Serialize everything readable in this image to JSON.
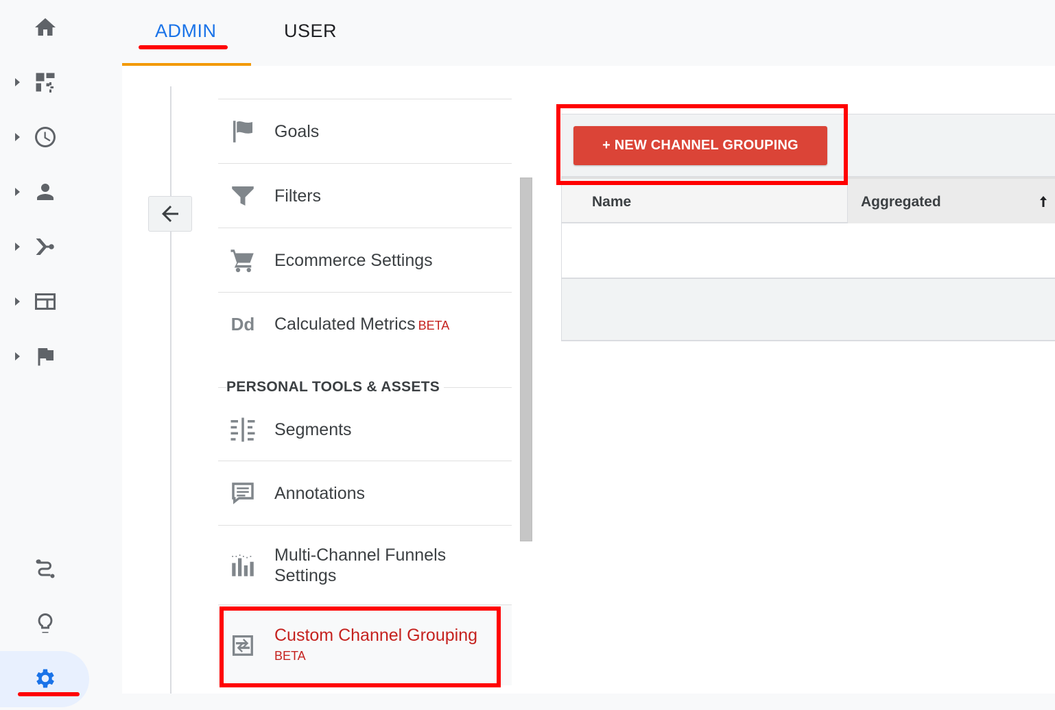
{
  "tabs": {
    "admin_label": "ADMIN",
    "user_label": "USER"
  },
  "menu": {
    "items": [
      {
        "label": "Goals",
        "icon": "flag-icon"
      },
      {
        "label": "Filters",
        "icon": "filter-icon"
      },
      {
        "label": "Ecommerce Settings",
        "icon": "cart-icon"
      },
      {
        "label": "Calculated Metrics",
        "badge": "BETA",
        "icon": "dd-icon"
      }
    ],
    "section_heading": "PERSONAL TOOLS & ASSETS",
    "personal_items": [
      {
        "label": "Segments",
        "icon": "segments-icon"
      },
      {
        "label": "Annotations",
        "icon": "annotations-icon"
      },
      {
        "label_line1": "Multi-Channel Funnels",
        "label_line2": "Settings",
        "icon": "funnels-icon"
      },
      {
        "label": "Custom Channel Grouping",
        "badge": "BETA",
        "icon": "channel-grouping-icon"
      }
    ],
    "dd_glyph": "Dd"
  },
  "toolbar": {
    "new_button_label": "+ NEW CHANNEL GROUPING"
  },
  "table": {
    "columns": [
      "Name",
      "Aggregated"
    ],
    "sort_column": "Aggregated",
    "sort_direction": "ascending",
    "rows": []
  },
  "colors": {
    "accent": "#1a73e8",
    "primary_button": "#db4437",
    "highlight": "#ff0000",
    "active_text": "#c5221f"
  }
}
